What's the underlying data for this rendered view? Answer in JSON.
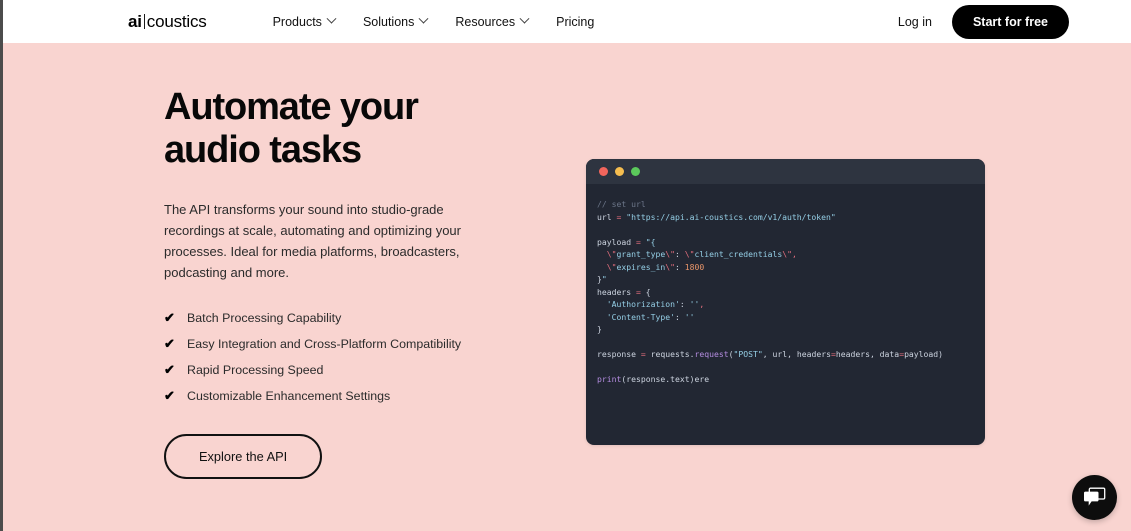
{
  "nav": {
    "logo": {
      "primary": "ai",
      "secondary": "coustics"
    },
    "links": [
      {
        "label": "Products",
        "has_dropdown": true
      },
      {
        "label": "Solutions",
        "has_dropdown": true
      },
      {
        "label": "Resources",
        "has_dropdown": true
      },
      {
        "label": "Pricing",
        "has_dropdown": false
      }
    ],
    "login_label": "Log in",
    "cta_label": "Start for free"
  },
  "hero": {
    "headline_line1": "Automate your",
    "headline_line2": "audio tasks",
    "subcopy": "The API transforms your sound into studio-grade recordings at scale, automating and optimizing your processes. Ideal for media platforms, broadcasters, podcasting and more.",
    "features": [
      {
        "check": "check-icon",
        "label": "Batch Processing Capability"
      },
      {
        "check": "check-icon",
        "label": "Easy Integration and Cross-Platform Compatibility"
      },
      {
        "check": "check-icon",
        "label": "Rapid Processing Speed"
      },
      {
        "check": "check-icon",
        "label": "Customizable Enhancement Settings"
      }
    ],
    "explore_label": "Explore the API"
  },
  "code_window": {
    "traffic_lights": [
      "close-dot-red",
      "minimize-dot-yellow",
      "maximize-dot-green"
    ],
    "lines": [
      {
        "type": "code",
        "tokens": [
          {
            "t": "// set url",
            "c": "tok-comment"
          }
        ]
      },
      {
        "type": "code",
        "tokens": [
          {
            "t": "url ",
            "c": "tok-plain"
          },
          {
            "t": "=",
            "c": "tok-op"
          },
          {
            "t": " ",
            "c": "tok-plain"
          },
          {
            "t": "\"https://api.ai-coustics.com/v1/auth/token\"",
            "c": "tok-str"
          }
        ]
      },
      {
        "type": "blank"
      },
      {
        "type": "code",
        "tokens": [
          {
            "t": "payload ",
            "c": "tok-plain"
          },
          {
            "t": "=",
            "c": "tok-op"
          },
          {
            "t": " ",
            "c": "tok-plain"
          },
          {
            "t": "\"{",
            "c": "tok-str"
          }
        ]
      },
      {
        "type": "code",
        "tokens": [
          {
            "t": "  ",
            "c": "tok-plain"
          },
          {
            "t": "\\\"",
            "c": "tok-op"
          },
          {
            "t": "grant_type",
            "c": "tok-str"
          },
          {
            "t": "\\\"",
            "c": "tok-op"
          },
          {
            "t": ": ",
            "c": "tok-plain"
          },
          {
            "t": "\\\"",
            "c": "tok-op"
          },
          {
            "t": "client_credentials",
            "c": "tok-str"
          },
          {
            "t": "\\\"",
            "c": "tok-op"
          },
          {
            "t": ",",
            "c": "tok-op"
          }
        ]
      },
      {
        "type": "code",
        "tokens": [
          {
            "t": "  ",
            "c": "tok-plain"
          },
          {
            "t": "\\\"",
            "c": "tok-op"
          },
          {
            "t": "expires_in",
            "c": "tok-str"
          },
          {
            "t": "\\\"",
            "c": "tok-op"
          },
          {
            "t": ": ",
            "c": "tok-plain"
          },
          {
            "t": "1800",
            "c": "tok-num"
          }
        ]
      },
      {
        "type": "code",
        "tokens": [
          {
            "t": "}",
            "c": "tok-plain"
          },
          {
            "t": "\"",
            "c": "tok-str"
          }
        ]
      },
      {
        "type": "code",
        "tokens": [
          {
            "t": "headers ",
            "c": "tok-plain"
          },
          {
            "t": "=",
            "c": "tok-op"
          },
          {
            "t": " {",
            "c": "tok-plain"
          }
        ]
      },
      {
        "type": "code",
        "tokens": [
          {
            "t": "  ",
            "c": "tok-plain"
          },
          {
            "t": "'Authorization'",
            "c": "tok-str"
          },
          {
            "t": ": ",
            "c": "tok-plain"
          },
          {
            "t": "''",
            "c": "tok-str"
          },
          {
            "t": ",",
            "c": "tok-op"
          }
        ]
      },
      {
        "type": "code",
        "tokens": [
          {
            "t": "  ",
            "c": "tok-plain"
          },
          {
            "t": "'Content-Type'",
            "c": "tok-str"
          },
          {
            "t": ": ",
            "c": "tok-plain"
          },
          {
            "t": "''",
            "c": "tok-str"
          }
        ]
      },
      {
        "type": "code",
        "tokens": [
          {
            "t": "}",
            "c": "tok-plain"
          }
        ]
      },
      {
        "type": "blank"
      },
      {
        "type": "code",
        "tokens": [
          {
            "t": "response ",
            "c": "tok-plain"
          },
          {
            "t": "=",
            "c": "tok-op"
          },
          {
            "t": " requests.",
            "c": "tok-plain"
          },
          {
            "t": "request",
            "c": "tok-func"
          },
          {
            "t": "(",
            "c": "tok-plain"
          },
          {
            "t": "\"POST\"",
            "c": "tok-str"
          },
          {
            "t": ", url, headers",
            "c": "tok-plain"
          },
          {
            "t": "=",
            "c": "tok-op"
          },
          {
            "t": "headers, data",
            "c": "tok-plain"
          },
          {
            "t": "=",
            "c": "tok-op"
          },
          {
            "t": "payload)",
            "c": "tok-plain"
          }
        ]
      },
      {
        "type": "blank"
      },
      {
        "type": "code",
        "tokens": [
          {
            "t": "print",
            "c": "tok-func"
          },
          {
            "t": "(response.text)ere",
            "c": "tok-plain"
          }
        ]
      }
    ]
  },
  "chat": {
    "icon": "chat-bubble-icon"
  },
  "colors": {
    "page_background": "#f9d4d0",
    "nav_background": "#ffffff",
    "cta_background": "#000000",
    "code_background": "#222733",
    "code_titlebar": "#2e3440",
    "dot_red": "#f2655c",
    "dot_yellow": "#f5bd4f",
    "dot_green": "#5bc95b"
  }
}
